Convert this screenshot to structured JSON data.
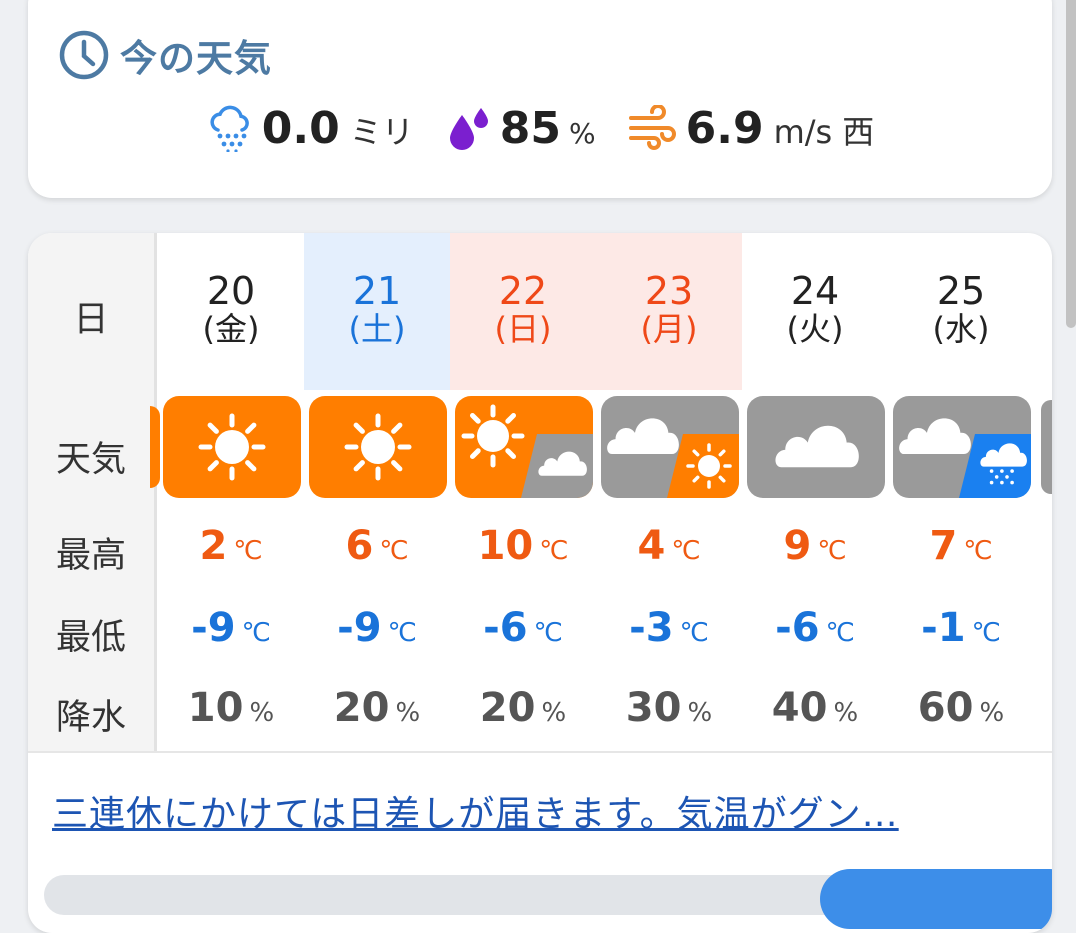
{
  "current": {
    "title": "今の天気",
    "rain_value": "0.0",
    "rain_unit": "ミリ",
    "humidity_value": "85",
    "humidity_unit": "%",
    "wind_value": "6.9",
    "wind_unit": "m/s",
    "wind_dir": "西",
    "icons": [
      "clock-icon",
      "rain-cloud-icon",
      "humidity-drop-icon",
      "wind-icon"
    ]
  },
  "forecast": {
    "labels": {
      "date": "日",
      "weather": "天気",
      "high": "最高",
      "low": "最低",
      "precip": "降水"
    },
    "temp_unit": "℃",
    "precip_unit": "%",
    "days": [
      {
        "date": "20",
        "weekday": "(金)",
        "weather": "sunny",
        "high": "2",
        "low": "-9",
        "precip": "10"
      },
      {
        "date": "21",
        "weekday": "(土)",
        "weather": "sunny",
        "high": "6",
        "low": "-9",
        "precip": "20"
      },
      {
        "date": "22",
        "weekday": "(日)",
        "weather": "sunny-then-cloudy",
        "high": "10",
        "low": "-6",
        "precip": "20"
      },
      {
        "date": "23",
        "weekday": "(月)",
        "weather": "cloudy-then-sunny",
        "high": "4",
        "low": "-3",
        "precip": "30"
      },
      {
        "date": "24",
        "weekday": "(火)",
        "weather": "cloudy",
        "high": "9",
        "low": "-6",
        "precip": "40"
      },
      {
        "date": "25",
        "weekday": "(水)",
        "weather": "cloudy-then-rain",
        "high": "7",
        "low": "-1",
        "precip": "60"
      }
    ]
  },
  "colors": {
    "saturday": "#1a73d9",
    "holiday": "#ef4818",
    "weekday": "#222222",
    "saturday_bg": "#e4effd",
    "holiday_bg": "#fde9e6",
    "sunny": "#ff7e00",
    "cloudy": "#9a9a9a",
    "rain": "#1a80f0"
  },
  "news": {
    "headline": "三連休にかけては日差しが届きます。気温がグン…"
  }
}
